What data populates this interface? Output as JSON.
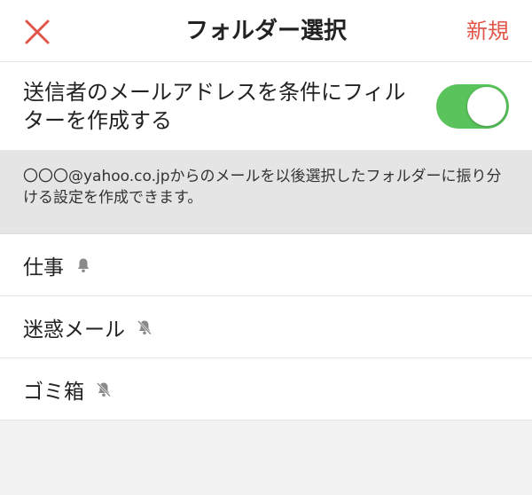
{
  "header": {
    "title": "フォルダー選択",
    "new_label": "新規",
    "accent_color": "#e0564a"
  },
  "filter_toggle": {
    "label": "送信者のメールアドレスを条件にフィルターを作成する",
    "enabled": true,
    "on_color": "#5ac35c"
  },
  "info": {
    "text": "〇〇〇@yahoo.co.jpからのメールを以後選択したフォルダーに振り分ける設定を作成できます。"
  },
  "folders": [
    {
      "name": "仕事",
      "bell_icon": "bell-icon"
    },
    {
      "name": "迷惑メール",
      "bell_icon": "bell-off-icon"
    },
    {
      "name": "ゴミ箱",
      "bell_icon": "bell-off-icon"
    }
  ]
}
